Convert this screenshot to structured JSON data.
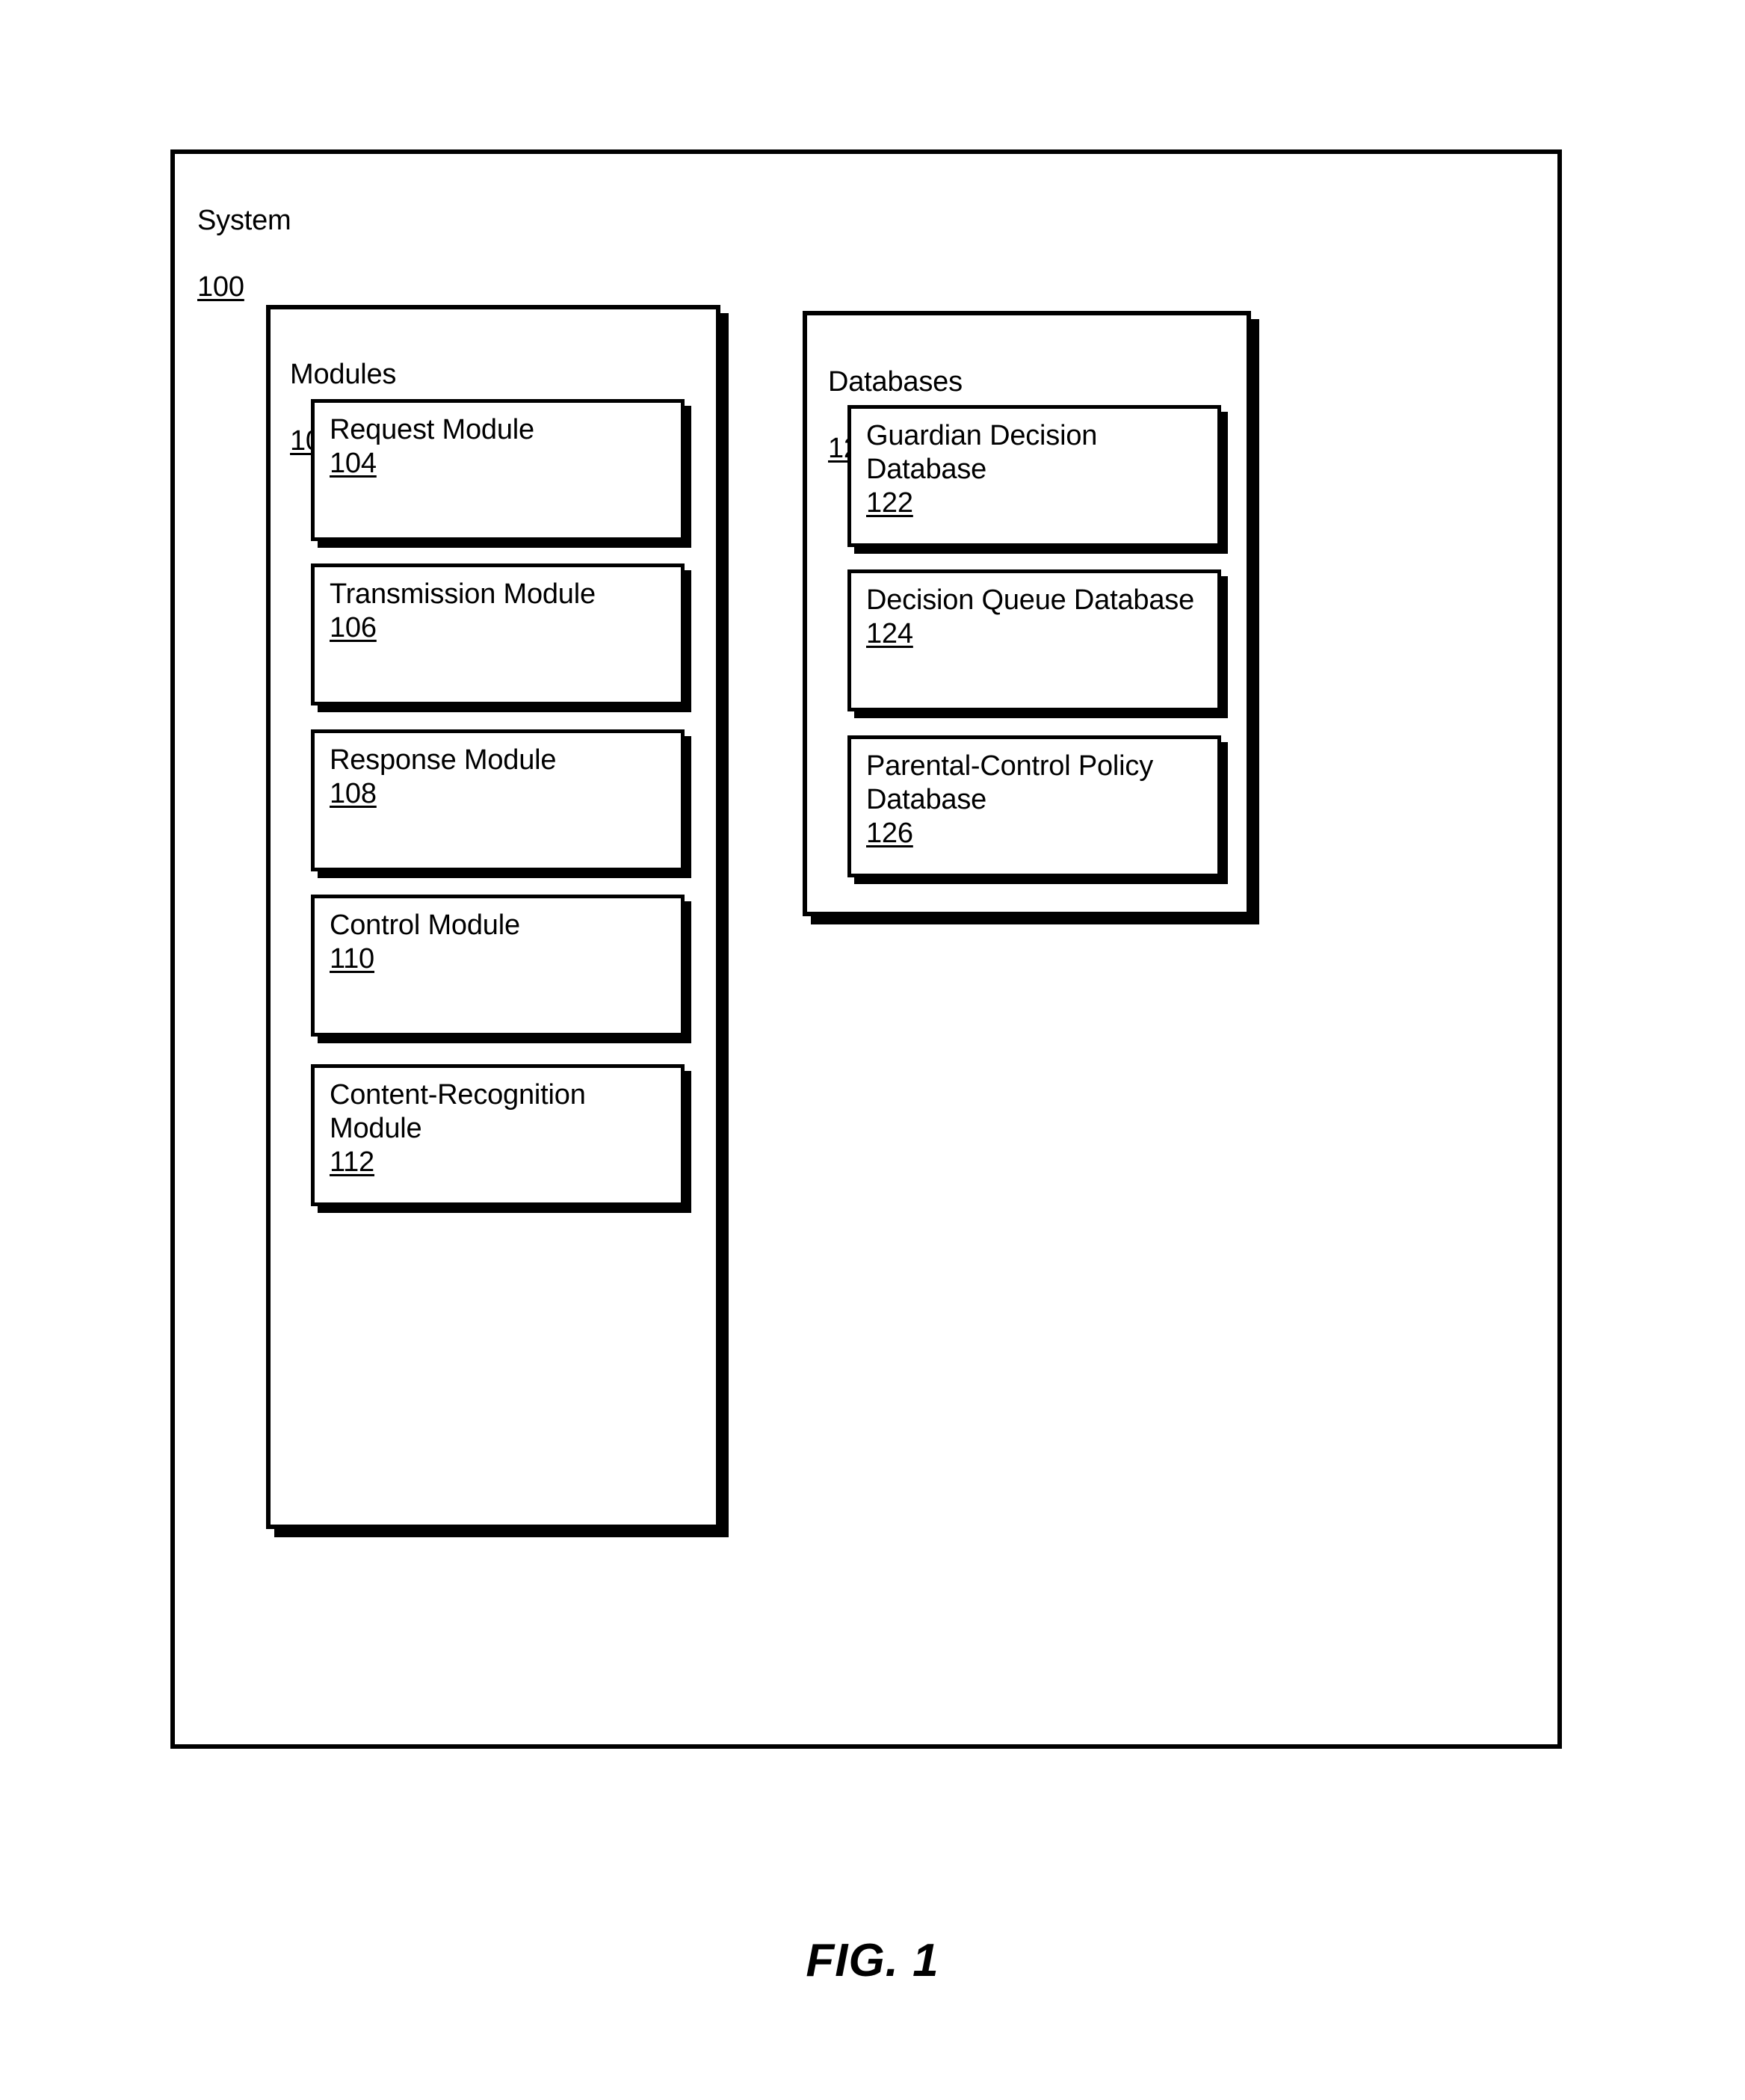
{
  "figure": {
    "caption": "FIG. 1"
  },
  "system": {
    "title": "System",
    "ref": "100"
  },
  "modules": {
    "title": "Modules",
    "ref": "102",
    "items": [
      {
        "title": "Request Module",
        "ref": "104"
      },
      {
        "title": "Transmission Module",
        "ref": "106"
      },
      {
        "title": "Response Module",
        "ref": "108"
      },
      {
        "title": "Control Module",
        "ref": "110"
      },
      {
        "title": "Content-Recognition Module",
        "ref": "112"
      }
    ]
  },
  "databases": {
    "title": "Databases",
    "ref": "120",
    "items": [
      {
        "title": "Guardian Decision Database",
        "ref": "122"
      },
      {
        "title": "Decision Queue Database",
        "ref": "124"
      },
      {
        "title": "Parental-Control Policy Database",
        "ref": "126"
      }
    ]
  },
  "colors": {
    "ink": "#000000",
    "paper": "#ffffff"
  }
}
